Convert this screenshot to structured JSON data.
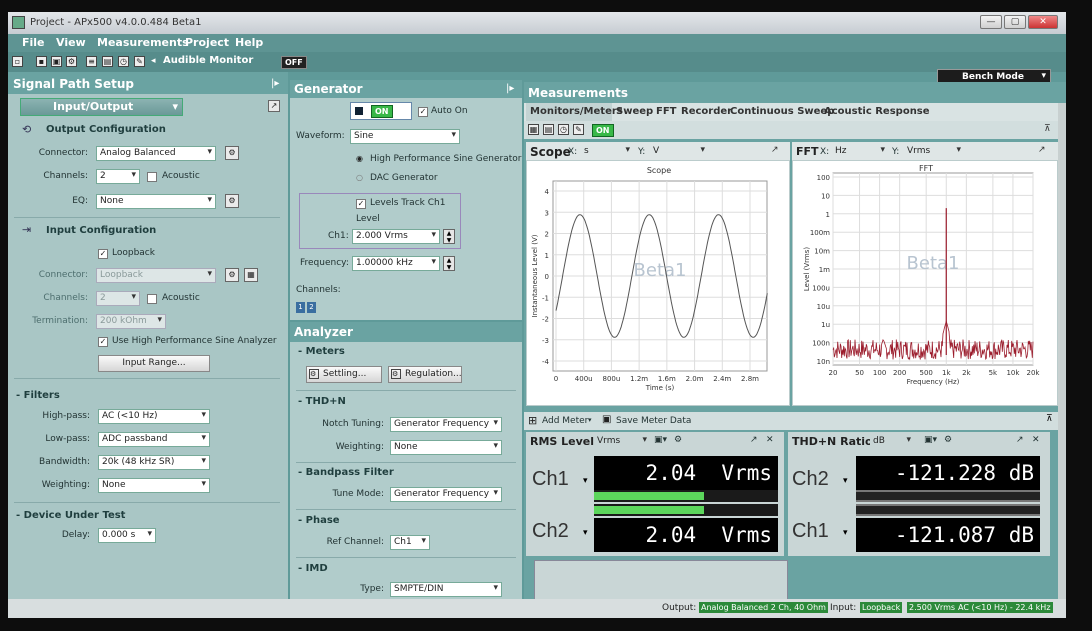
{
  "window": {
    "title": "Project - APx500 v4.0.0.484 Beta1",
    "controls": [
      "—",
      "▢",
      "✕"
    ]
  },
  "menu": [
    "File",
    "View",
    "Measurements",
    "Project",
    "Help"
  ],
  "toolbar": {
    "audible_monitor": "Audible Monitor",
    "off": "OFF",
    "bench_mode": "Bench Mode"
  },
  "signal_path": {
    "title": "Signal Path Setup",
    "selector": "Input/Output",
    "output_config": {
      "title": "Output Configuration",
      "connector_label": "Connector:",
      "connector": "Analog Balanced",
      "channels_label": "Channels:",
      "channels": "2",
      "acoustic": "Acoustic",
      "eq_label": "EQ:",
      "eq": "None"
    },
    "input_config": {
      "title": "Input Configuration",
      "loopback": "Loopback",
      "connector_label": "Connector:",
      "connector": "Loopback",
      "channels_label": "Channels:",
      "channels": "2",
      "acoustic": "Acoustic",
      "termination_label": "Termination:",
      "termination": "200 kOhm",
      "hp_analyzer": "Use High Performance Sine Analyzer",
      "input_range": "Input Range..."
    },
    "filters": {
      "title": "Filters",
      "highpass_label": "High-pass:",
      "highpass": "AC (<10 Hz)",
      "lowpass_label": "Low-pass:",
      "lowpass": "ADC passband",
      "bandwidth_label": "Bandwidth:",
      "bandwidth": "20k (48 kHz SR)",
      "weighting_label": "Weighting:",
      "weighting": "None"
    },
    "dut": {
      "title": "Device Under Test",
      "delay_label": "Delay:",
      "delay": "0.000 s"
    }
  },
  "generator": {
    "title": "Generator",
    "on": "ON",
    "auto_on": "Auto On",
    "waveform_label": "Waveform:",
    "waveform": "Sine",
    "hp_sine": "High Performance Sine Generator",
    "dac": "DAC Generator",
    "levels_track": "Levels Track Ch1",
    "level_label": "Level",
    "ch1_label": "Ch1:",
    "ch1": "2.000 Vrms",
    "freq_label": "Frequency:",
    "freq": "1.00000 kHz",
    "channels_label": "Channels:",
    "ch_buttons": [
      "1",
      "2"
    ]
  },
  "analyzer": {
    "title": "Analyzer",
    "meters": "Meters",
    "settling": "Settling...",
    "regulation": "Regulation...",
    "thdn": "THD+N",
    "notch_label": "Notch Tuning:",
    "notch": "Generator Frequency",
    "weighting_label": "Weighting:",
    "weighting": "None",
    "bandpass": "Bandpass Filter",
    "tune_label": "Tune Mode:",
    "tune": "Generator Frequency",
    "phase": "Phase",
    "refch_label": "Ref Channel:",
    "refch": "Ch1",
    "imd": "IMD",
    "type_label": "Type:",
    "type": "SMPTE/DIN"
  },
  "measurements": {
    "title": "Measurements",
    "tabs": [
      "Monitors/Meters",
      "Sweep",
      "FFT",
      "Recorder",
      "Continuous Sweep",
      "Acoustic Response"
    ],
    "on": "ON",
    "scope": {
      "title": "Scope",
      "x_label": "X:",
      "x_unit": "s",
      "y_label": "Y:",
      "y_unit": "V",
      "subtitle": "Scope",
      "watermark": "Beta1",
      "ylabel": "Instantaneous Level (V)",
      "xlabel": "Time (s)",
      "yticks": [
        "4",
        "3",
        "2",
        "1",
        "0",
        "-1",
        "-2",
        "-3",
        "-4"
      ],
      "xticks": [
        "0",
        "400u",
        "800u",
        "1.2m",
        "1.6m",
        "2.0m",
        "2.4m",
        "2.8m"
      ]
    },
    "fft": {
      "title": "FFT",
      "x_label": "X:",
      "x_unit": "Hz",
      "y_label": "Y:",
      "y_unit": "Vrms",
      "subtitle": "FFT",
      "watermark": "Beta1",
      "ylabel": "Level (Vrms)",
      "xlabel": "Frequency (Hz)",
      "yticks": [
        "100",
        "10",
        "1",
        "100m",
        "10m",
        "1m",
        "100u",
        "10u",
        "1u",
        "100n",
        "10n"
      ],
      "xticks": [
        "20",
        "50",
        "100",
        "200",
        "500",
        "1k",
        "2k",
        "5k",
        "10k",
        "20k"
      ]
    },
    "add_meter": "Add Meter",
    "save_meter": "Save Meter Data",
    "rms": {
      "title": "RMS Level",
      "unit": "Vrms",
      "rows": [
        {
          "ch": "Ch1",
          "value": "2.04",
          "unit": "Vrms",
          "level": 0.6
        },
        {
          "ch": "Ch2",
          "value": "2.04",
          "unit": "Vrms",
          "level": 0.6
        }
      ]
    },
    "thdn": {
      "title": "THD+N Ratio",
      "unit": "dB",
      "rows": [
        {
          "ch": "Ch2",
          "value": "-121.228",
          "unit": "dB"
        },
        {
          "ch": "Ch1",
          "value": "-121.087",
          "unit": "dB"
        }
      ]
    }
  },
  "status": {
    "output_label": "Output:",
    "output": "Analog Balanced 2 Ch, 40 Ohm",
    "input_label": "Input:",
    "input": "Loopback",
    "level": "2.500 Vrms",
    "filter": "AC (<10 Hz) - 22.4 kHz"
  }
}
